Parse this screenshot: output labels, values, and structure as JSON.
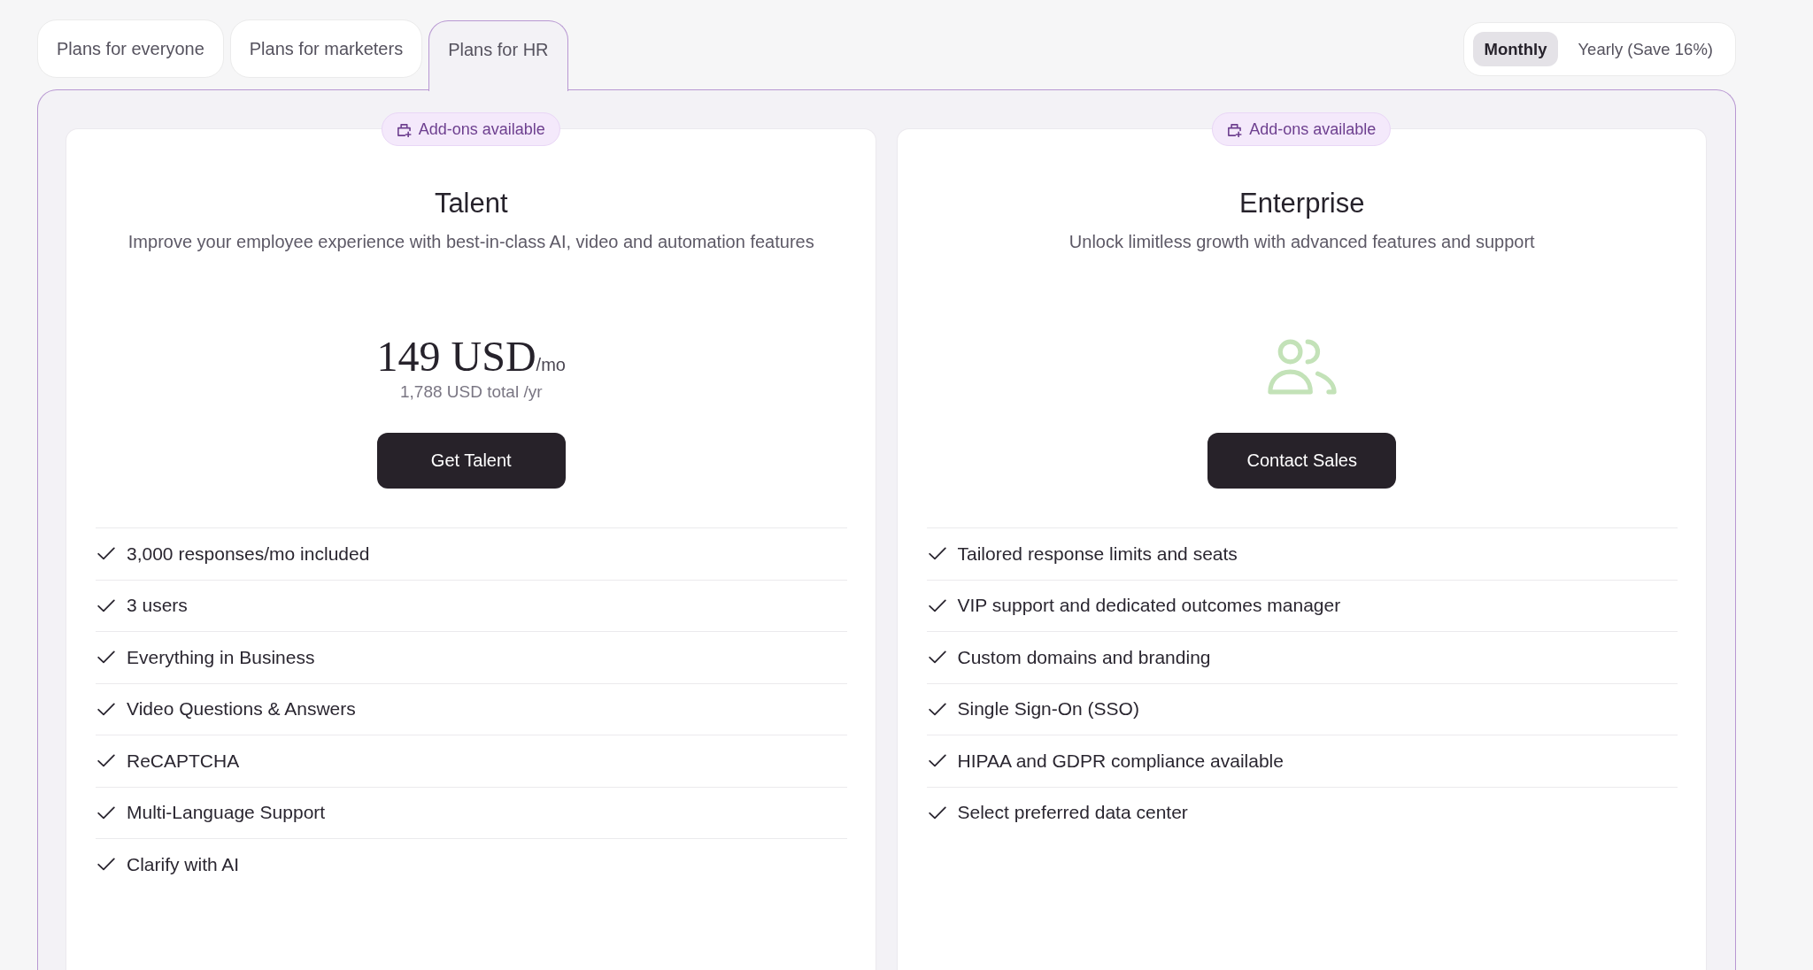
{
  "tabs": [
    {
      "label": "Plans for everyone",
      "selected": false
    },
    {
      "label": "Plans for marketers",
      "selected": false
    },
    {
      "label": "Plans for HR",
      "selected": true
    }
  ],
  "billing_toggle": [
    {
      "label": "Monthly",
      "selected": true
    },
    {
      "label": "Yearly (Save 16%)",
      "selected": false
    }
  ],
  "plans": [
    {
      "kind": "priced",
      "badge": "Add-ons available",
      "name": "Talent",
      "description": "Improve your employee experience with best-in-class AI, video and automation features",
      "price": "149 USD",
      "price_unit": "/mo",
      "price_note": "1,788 USD total /yr",
      "button": "Get Talent",
      "features": [
        "3,000 responses/mo included",
        "3 users",
        "Everything in Business",
        "Video Questions & Answers",
        "ReCAPTCHA",
        "Multi-Language Support",
        "Clarify with AI"
      ]
    },
    {
      "kind": "contact",
      "badge": "Add-ons available",
      "name": "Enterprise",
      "description": "Unlock limitless growth with advanced features and support",
      "button": "Contact Sales",
      "features": [
        "Tailored response limits and seats",
        "VIP support and dedicated outcomes manager",
        "Custom domains and branding",
        "Single Sign-On (SSO)",
        "HIPAA and GDPR compliance available",
        "Select preferred data center"
      ]
    }
  ]
}
